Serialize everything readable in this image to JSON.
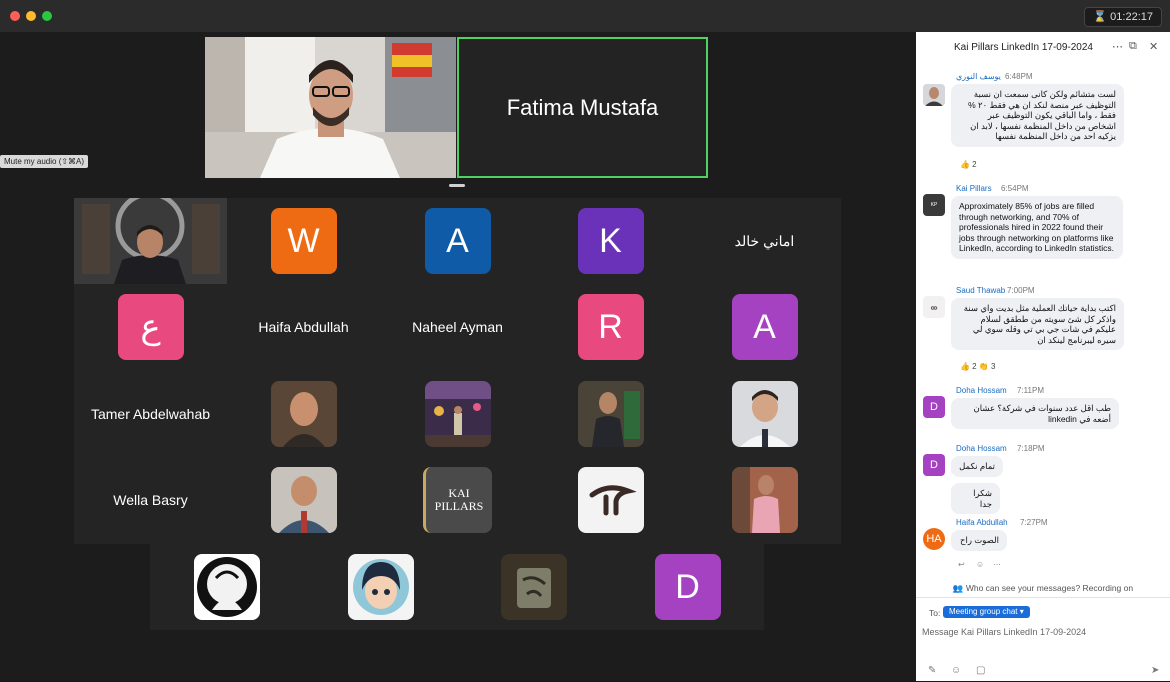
{
  "window": {
    "timer": "01:22:17"
  },
  "stage": {
    "pinned": [
      {
        "kind": "video"
      },
      {
        "kind": "name",
        "name": "Fatima Mustafa"
      }
    ],
    "mute_tooltip": "Mute my audio (⇧⌘A)",
    "tiles": [
      {
        "kind": "video",
        "bg": "#3a3a3a"
      },
      {
        "kind": "letter",
        "letter": "W",
        "color": "#ee6b14"
      },
      {
        "kind": "letter",
        "letter": "A",
        "color": "#0f5ba8"
      },
      {
        "kind": "letter",
        "letter": "K",
        "color": "#6a32b8"
      },
      {
        "kind": "name",
        "name": "اماني خالد"
      },
      {
        "kind": "letter",
        "letter": "ع",
        "color": "#e84a7f"
      },
      {
        "kind": "name",
        "name": "Haifa Abdullah"
      },
      {
        "kind": "name",
        "name": "Naheel Ayman"
      },
      {
        "kind": "letter",
        "letter": "R",
        "color": "#e84a7f"
      },
      {
        "kind": "letter",
        "letter": "A",
        "color": "#a542c2"
      },
      {
        "kind": "name",
        "name": "Tamer Abdelwahab"
      },
      {
        "kind": "photo",
        "bg": "#5a4636"
      },
      {
        "kind": "photo",
        "bg": "#3b2d49"
      },
      {
        "kind": "photo",
        "bg": "#4a4438"
      },
      {
        "kind": "photo",
        "bg": "#d8dadd"
      },
      {
        "kind": "name",
        "name": "Wella Basry"
      },
      {
        "kind": "photo",
        "bg": "#c7c3bc"
      },
      {
        "kind": "photo",
        "bg": "#4a4a4a",
        "logo": "KAI PILLARS"
      },
      {
        "kind": "photo",
        "bg": "#f3f3f3"
      },
      {
        "kind": "photo",
        "bg": "#a3634a"
      },
      {
        "kind": "photo",
        "bg": "#ffffff"
      },
      {
        "kind": "photo",
        "bg": "#f4f4f4"
      },
      {
        "kind": "photo",
        "bg": "#3a3326"
      },
      {
        "kind": "letter",
        "letter": "D",
        "color": "#a542c2"
      }
    ]
  },
  "chat": {
    "title": "Kai Pillars LinkedIn 17-09-2024",
    "messages": [
      {
        "name": "يوسف النوري",
        "time": "6:48PM",
        "text": "لست متشائم ولكن كانى سمعت ان نسبة التوظيف عبر منصة لنكد ان هي فقط ٢٠ % فقط ، واما الباقي يكون التوظيف عبر اشخاص من داخل المنظمة نفسها ، لابد ان يزكيه احد من داخل المنظمة نفسها",
        "reactions": "👍 2"
      },
      {
        "name": "Kai Pillars",
        "time": "6:54PM",
        "text": "Approximately 85% of jobs are filled through networking, and 70% of professionals hired in 2022 found their jobs through networking on platforms like LinkedIn, according to LinkedIn statistics."
      },
      {
        "name": "Saud Thawab",
        "time": "7:00PM",
        "text": "اكتب بداية حياتك العملية مثل بديت واي سنة واذكر كل شئ سويته من ططقق لسلام عليكم في شات جي بي تي وقله سوي لي سيره ليبرنامج لينكد ان",
        "reactions": "👍 2   👏 3"
      },
      {
        "name": "Doha Hossam",
        "time": "7:11PM",
        "text": "طب اقل عدد سنوات في شركة؟ عشان أضعه في linkedin"
      },
      {
        "name": "Doha Hossam",
        "time": "7:18PM",
        "text": "تمام نكمل",
        "text2": "شكرا جدا"
      },
      {
        "name": "Haifa Abdullah",
        "time": "7:27PM",
        "text": "الصوت راح",
        "initials": "HA"
      }
    ],
    "privacy": "Who can see your messages? Recording on",
    "to_label": "To:",
    "recipient": "Meeting group chat",
    "input_placeholder": "Message Kai Pillars LinkedIn 17-09-2024"
  }
}
